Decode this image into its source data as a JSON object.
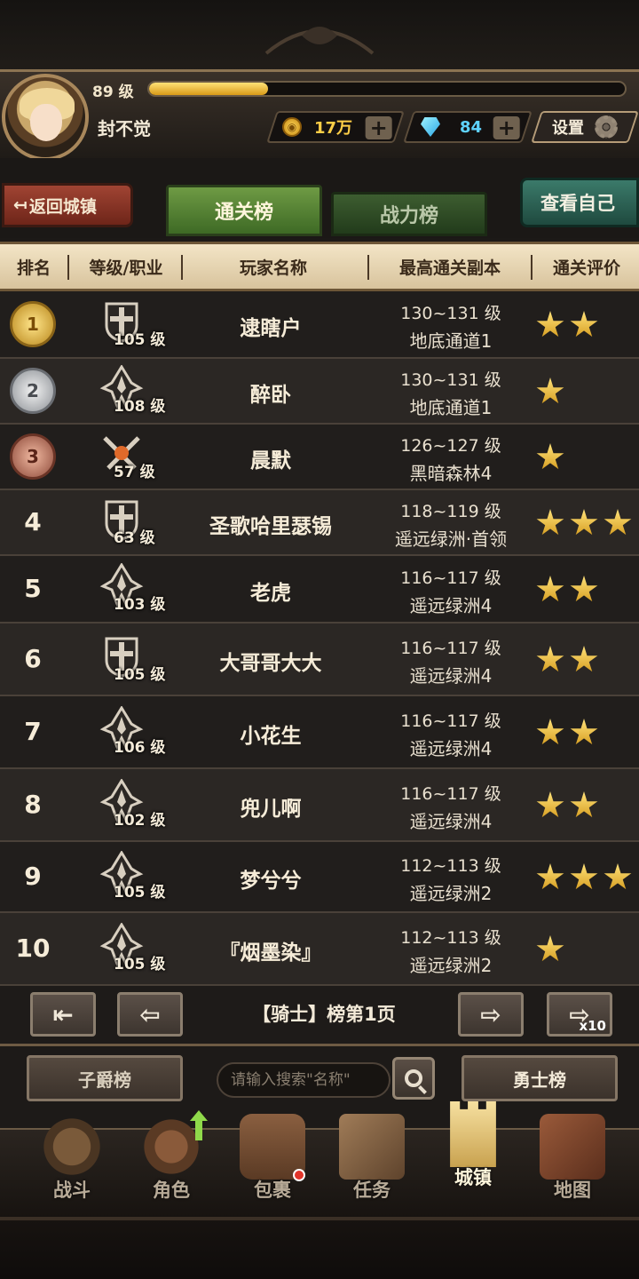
{
  "header": {
    "level": "89 级",
    "xp_progress": 0.25,
    "player_name": "封不觉",
    "gold": "17万",
    "gems": "84",
    "settings_label": "设置"
  },
  "tabs": {
    "back_label": "返回城镇",
    "items": [
      {
        "label": "通关榜",
        "active": true
      },
      {
        "label": "战力榜",
        "active": false
      }
    ],
    "view_self_label": "查看自己"
  },
  "columns": [
    "排名",
    "等级/职业",
    "玩家名称",
    "最高通关副本",
    "通关评价"
  ],
  "rows": [
    {
      "rank": "1",
      "level": "105 级",
      "class_icon": "cross-shield-icon",
      "name": "逮瞎户",
      "range": "130~131 级",
      "dungeon": "地底通道1",
      "stars": 2
    },
    {
      "rank": "2",
      "level": "108 级",
      "class_icon": "flame-spire-icon",
      "name": "醉卧",
      "range": "130~131 级",
      "dungeon": "地底通道1",
      "stars": 1
    },
    {
      "rank": "3",
      "level": "57 级",
      "class_icon": "crossed-swords-icon",
      "name": "晨默",
      "range": "126~127 级",
      "dungeon": "黑暗森林4",
      "stars": 1
    },
    {
      "rank": "4",
      "level": "63 级",
      "class_icon": "cross-shield-icon",
      "name": "圣歌哈里瑟锡",
      "range": "118~119 级",
      "dungeon": "遥远绿洲·首领",
      "stars": 3
    },
    {
      "rank": "5",
      "level": "103 级",
      "class_icon": "flame-spire-icon",
      "name": "老虎",
      "range": "116~117 级",
      "dungeon": "遥远绿洲4",
      "stars": 2
    },
    {
      "rank": "6",
      "level": "105 级",
      "class_icon": "cross-shield-icon",
      "name": "大哥哥大大",
      "range": "116~117 级",
      "dungeon": "遥远绿洲4",
      "stars": 2
    },
    {
      "rank": "7",
      "level": "106 级",
      "class_icon": "flame-spire-icon",
      "name": "小花生",
      "range": "116~117 级",
      "dungeon": "遥远绿洲4",
      "stars": 2
    },
    {
      "rank": "8",
      "level": "102 级",
      "class_icon": "flame-spire-icon",
      "name": "兜儿啊",
      "range": "116~117 级",
      "dungeon": "遥远绿洲4",
      "stars": 2
    },
    {
      "rank": "9",
      "level": "105 级",
      "class_icon": "flame-spire-icon",
      "name": "梦兮兮",
      "range": "112~113 级",
      "dungeon": "遥远绿洲2",
      "stars": 3
    },
    {
      "rank": "10",
      "level": "105 级",
      "class_icon": "flame-spire-icon",
      "name": "『烟墨染』",
      "range": "112~113 级",
      "dungeon": "遥远绿洲2",
      "stars": 1
    }
  ],
  "pager": {
    "label": "【骑士】榜第1页",
    "x10_label": "x10"
  },
  "bottom": {
    "left_button": "子爵榜",
    "search_placeholder": "请输入搜索\"名称\"",
    "right_button": "勇士榜"
  },
  "nav": [
    {
      "label": "战斗",
      "icon": "battle-shield-icon"
    },
    {
      "label": "角色",
      "icon": "helmet-icon"
    },
    {
      "label": "包裹",
      "icon": "backpack-icon"
    },
    {
      "label": "任务",
      "icon": "scroll-icon"
    },
    {
      "label": "城镇",
      "icon": "tower-icon",
      "active": true
    },
    {
      "label": "地图",
      "icon": "map-icon"
    }
  ],
  "colors": {
    "accent_gold": "#e0a820",
    "active_tab": "#5a8a3a",
    "back_button": "#8a3a2a",
    "self_button": "#2f6656"
  }
}
